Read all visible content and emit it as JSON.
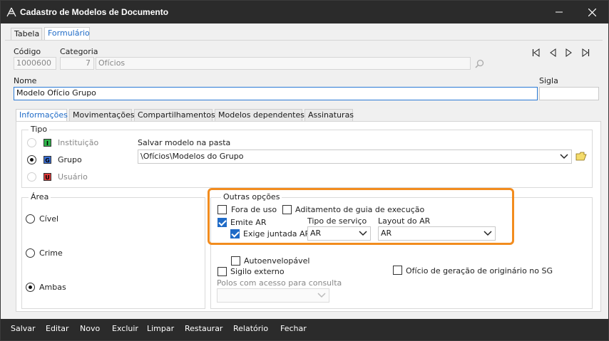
{
  "window": {
    "title": "Cadastro de Modelos de Documento"
  },
  "tabs": {
    "tabela": "Tabela",
    "formulario": "Formulário"
  },
  "form": {
    "codigo_label": "Código",
    "codigo_value": "1000600",
    "categoria_label": "Categoria",
    "categoria_num": "7",
    "categoria_text": "Ofícios",
    "nome_label": "Nome",
    "nome_value": "Modelo Ofício Grupo",
    "sigla_label": "Sigla",
    "sigla_value": ""
  },
  "subtabs": [
    "Informações",
    "Movimentações",
    "Compartilhamentos",
    "Modelos dependentes",
    "Assinaturas"
  ],
  "tipo": {
    "label": "Tipo",
    "options": [
      {
        "label": "Instituição",
        "badge": "I",
        "badge_color": "#2fb34a",
        "selected": false,
        "disabled": true
      },
      {
        "label": "Grupo",
        "badge": "G",
        "badge_color": "#3b6fd6",
        "selected": true,
        "disabled": false
      },
      {
        "label": "Usuário",
        "badge": "U",
        "badge_color": "#e23b3b",
        "selected": false,
        "disabled": true
      }
    ],
    "pasta_label": "Salvar modelo na pasta",
    "pasta_value": "\\Ofícios\\Modelos do Grupo"
  },
  "area": {
    "label": "Área",
    "options": [
      {
        "label": "Cível",
        "selected": false
      },
      {
        "label": "Crime",
        "selected": false
      },
      {
        "label": "Ambas",
        "selected": true
      }
    ]
  },
  "outras": {
    "label": "Outras opções",
    "fora_de_uso": "Fora de uso",
    "aditamento": "Aditamento de guia de execução",
    "emite_ar": "Emite AR",
    "exige_juntada": "Exige juntada AR",
    "tipo_servico_label": "Tipo de serviço",
    "tipo_servico_value": "AR",
    "layout_label": "Layout do AR",
    "layout_value": "AR",
    "autoenvelopavel": "Autoenvelopável",
    "sigilo": "Sigilo externo",
    "oficio_geracao": "Ofício de geração de originário no SG",
    "polos_label": "Polos com acesso para consulta"
  },
  "toolbar": [
    "Salvar",
    "Editar",
    "Novo",
    "Excluir",
    "Limpar",
    "Restaurar",
    "Relatório",
    "Fechar"
  ],
  "colors": {
    "accent": "#1f6bc7",
    "highlight": "#f28c1e",
    "titlebar": "#2b2b2b"
  }
}
